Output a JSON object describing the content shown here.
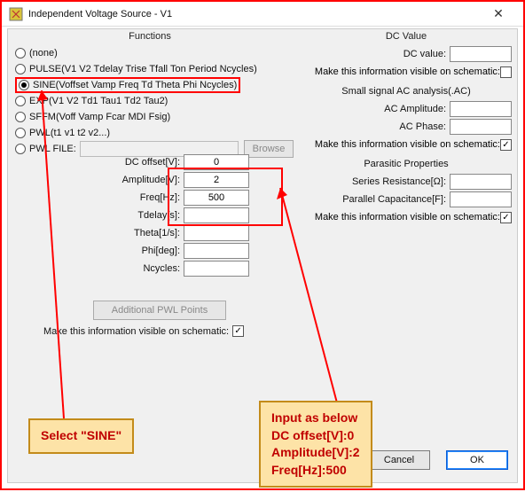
{
  "window": {
    "title": "Independent Voltage Source - V1"
  },
  "functions": {
    "heading": "Functions",
    "options": {
      "none": "(none)",
      "pulse": "PULSE(V1 V2 Tdelay Trise Tfall Ton Period Ncycles)",
      "sine": "SINE(Voffset Vamp Freq Td Theta Phi Ncycles)",
      "exp": "EXP(V1 V2 Td1 Tau1 Td2 Tau2)",
      "sffm": "SFFM(Voff Vamp Fcar MDI Fsig)",
      "pwl": "PWL(t1 v1 t2 v2...)",
      "pwlfile": "PWL FILE:"
    },
    "browse": "Browse",
    "addpwl": "Additional PWL Points",
    "schem": "Make this information visible on schematic:"
  },
  "params": {
    "labels": {
      "dcoffset": "DC offset[V]:",
      "amplitude": "Amplitude[V]:",
      "freq": "Freq[Hz]:",
      "tdelay": "Tdelay[s]:",
      "theta": "Theta[1/s]:",
      "phi": "Phi[deg]:",
      "ncycles": "Ncycles:"
    },
    "values": {
      "dcoffset": "0",
      "amplitude": "2",
      "freq": "500",
      "tdelay": "",
      "theta": "",
      "phi": "",
      "ncycles": ""
    }
  },
  "dc": {
    "heading": "DC Value",
    "label": "DC value:",
    "schem": "Make this information visible on schematic:"
  },
  "ac": {
    "heading": "Small signal AC analysis(.AC)",
    "amp": "AC Amplitude:",
    "phase": "AC Phase:",
    "schem": "Make this information visible on schematic:"
  },
  "para": {
    "heading": "Parasitic Properties",
    "r": "Series Resistance[Ω]:",
    "c": "Parallel Capacitance[F]:",
    "schem": "Make this information visible on schematic:"
  },
  "buttons": {
    "cancel": "Cancel",
    "ok": "OK"
  },
  "callouts": {
    "left": "Select \"SINE\"",
    "right": "Input as below\nDC offset[V]:0\nAmplitude[V]:2\nFreq[Hz]:500"
  }
}
